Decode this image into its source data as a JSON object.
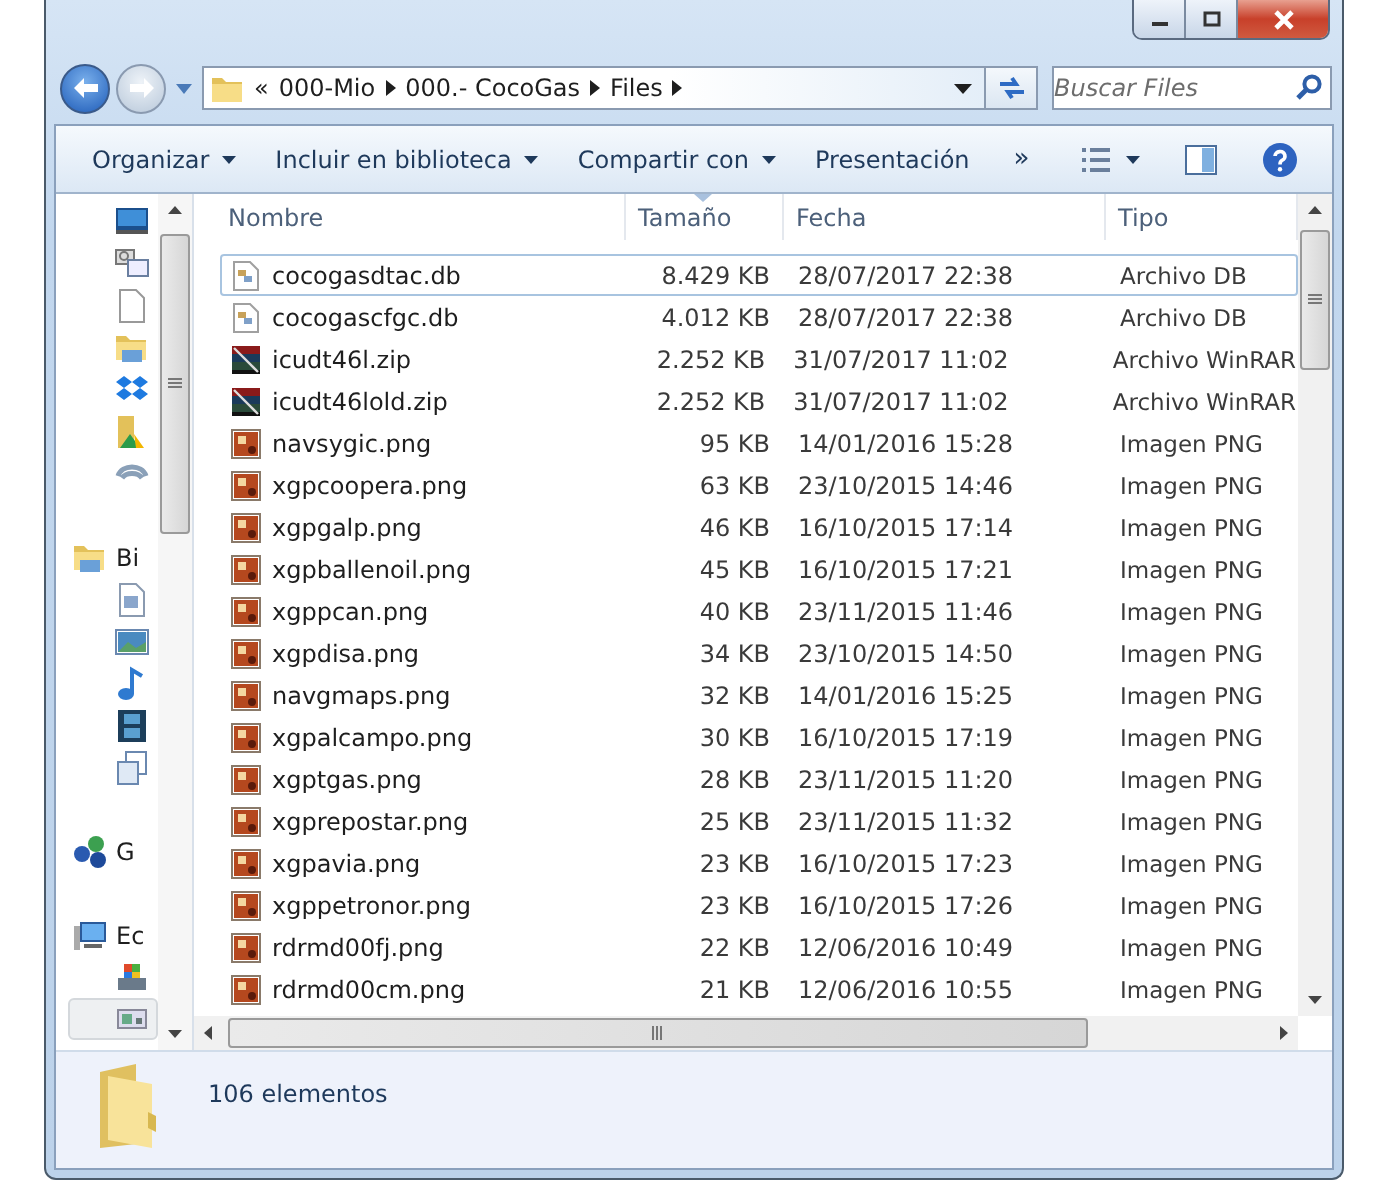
{
  "address": {
    "overflow": "«",
    "crumbs": [
      "000-Mio",
      "000.- CocoGas",
      "Files"
    ]
  },
  "search": {
    "placeholder": "Buscar Files"
  },
  "toolbar": {
    "items": [
      {
        "label": "Organizar",
        "dropdown": true
      },
      {
        "label": "Incluir en biblioteca",
        "dropdown": true
      },
      {
        "label": "Compartir con",
        "dropdown": true
      },
      {
        "label": "Presentación",
        "dropdown": false
      }
    ],
    "more": "»"
  },
  "sidebar": {
    "items": [
      {
        "kind": "item",
        "highlighted": false
      },
      {
        "kind": "item",
        "highlighted": false
      },
      {
        "kind": "item",
        "highlighted": false
      },
      {
        "kind": "item",
        "highlighted": false
      },
      {
        "kind": "item",
        "highlighted": false
      },
      {
        "kind": "item",
        "highlighted": false
      },
      {
        "kind": "item",
        "highlighted": false
      },
      {
        "kind": "header",
        "label": "Bi",
        "highlighted": false
      },
      {
        "kind": "item",
        "highlighted": false
      },
      {
        "kind": "item",
        "highlighted": false
      },
      {
        "kind": "item",
        "highlighted": false
      },
      {
        "kind": "item",
        "highlighted": false
      },
      {
        "kind": "item",
        "highlighted": false
      },
      {
        "kind": "header",
        "label": "G",
        "highlighted": false
      },
      {
        "kind": "header",
        "label": "Ec",
        "highlighted": false
      },
      {
        "kind": "item",
        "highlighted": false
      },
      {
        "kind": "item",
        "highlighted": true
      }
    ]
  },
  "table": {
    "columns": [
      {
        "label": "Nombre",
        "sorted": false
      },
      {
        "label": "Tamaño",
        "sorted": true
      },
      {
        "label": "Fecha",
        "sorted": false
      },
      {
        "label": "Tipo",
        "sorted": false
      }
    ],
    "rows": [
      {
        "kind": "db",
        "name": "cocogasdtac.db",
        "size": "8.429 KB",
        "date": "28/07/2017 22:38",
        "type": "Archivo DB",
        "focused": true
      },
      {
        "kind": "db",
        "name": "cocogascfgc.db",
        "size": "4.012 KB",
        "date": "28/07/2017 22:38",
        "type": "Archivo DB",
        "focused": false
      },
      {
        "kind": "zip",
        "name": "icudt46l.zip",
        "size": "2.252 KB",
        "date": "31/07/2017 11:02",
        "type": "Archivo WinRAR",
        "focused": false
      },
      {
        "kind": "zip",
        "name": "icudt46lold.zip",
        "size": "2.252 KB",
        "date": "31/07/2017 11:02",
        "type": "Archivo WinRAR",
        "focused": false
      },
      {
        "kind": "png",
        "name": "navsygic.png",
        "size": "95 KB",
        "date": "14/01/2016 15:28",
        "type": "Imagen PNG",
        "focused": false
      },
      {
        "kind": "png",
        "name": "xgpcoopera.png",
        "size": "63 KB",
        "date": "23/10/2015 14:46",
        "type": "Imagen PNG",
        "focused": false
      },
      {
        "kind": "png",
        "name": "xgpgalp.png",
        "size": "46 KB",
        "date": "16/10/2015 17:14",
        "type": "Imagen PNG",
        "focused": false
      },
      {
        "kind": "png",
        "name": "xgpballenoil.png",
        "size": "45 KB",
        "date": "16/10/2015 17:21",
        "type": "Imagen PNG",
        "focused": false
      },
      {
        "kind": "png",
        "name": "xgppcan.png",
        "size": "40 KB",
        "date": "23/11/2015 11:46",
        "type": "Imagen PNG",
        "focused": false
      },
      {
        "kind": "png",
        "name": "xgpdisa.png",
        "size": "34 KB",
        "date": "23/10/2015 14:50",
        "type": "Imagen PNG",
        "focused": false
      },
      {
        "kind": "png",
        "name": "navgmaps.png",
        "size": "32 KB",
        "date": "14/01/2016 15:25",
        "type": "Imagen PNG",
        "focused": false
      },
      {
        "kind": "png",
        "name": "xgpalcampo.png",
        "size": "30 KB",
        "date": "16/10/2015 17:19",
        "type": "Imagen PNG",
        "focused": false
      },
      {
        "kind": "png",
        "name": "xgptgas.png",
        "size": "28 KB",
        "date": "23/11/2015 11:20",
        "type": "Imagen PNG",
        "focused": false
      },
      {
        "kind": "png",
        "name": "xgprepostar.png",
        "size": "25 KB",
        "date": "23/11/2015 11:32",
        "type": "Imagen PNG",
        "focused": false
      },
      {
        "kind": "png",
        "name": "xgpavia.png",
        "size": "23 KB",
        "date": "16/10/2015 17:23",
        "type": "Imagen PNG",
        "focused": false
      },
      {
        "kind": "png",
        "name": "xgppetronor.png",
        "size": "23 KB",
        "date": "16/10/2015 17:26",
        "type": "Imagen PNG",
        "focused": false
      },
      {
        "kind": "png",
        "name": "rdrmd00fj.png",
        "size": "22 KB",
        "date": "12/06/2016 10:49",
        "type": "Imagen PNG",
        "focused": false
      },
      {
        "kind": "png",
        "name": "rdrmd00cm.png",
        "size": "21 KB",
        "date": "12/06/2016 10:55",
        "type": "Imagen PNG",
        "focused": false
      }
    ]
  },
  "status_bar": {
    "count": "106 elementos"
  }
}
